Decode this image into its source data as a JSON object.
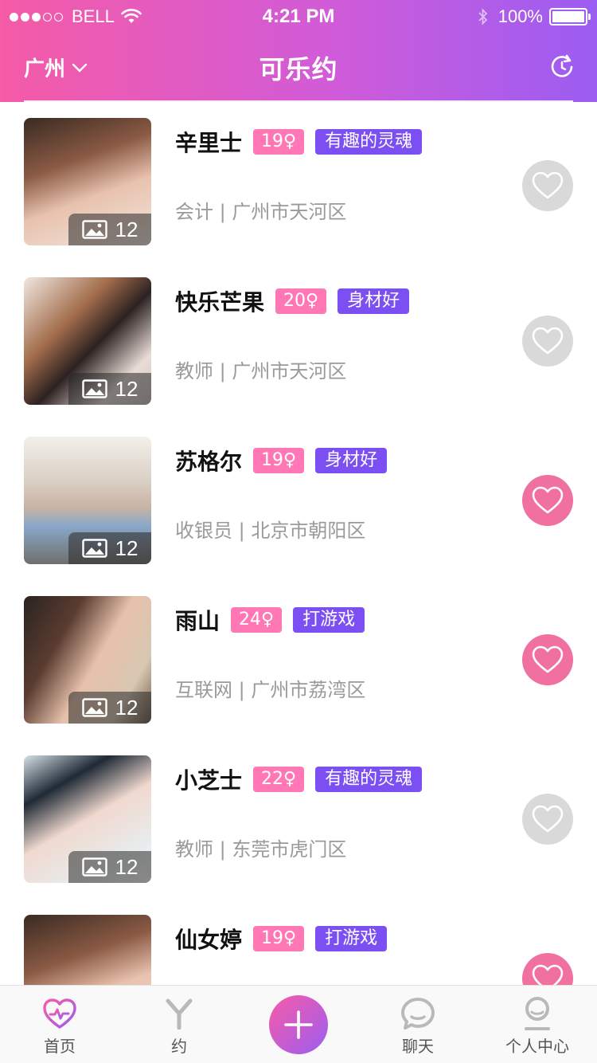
{
  "status_bar": {
    "carrier": "BELL",
    "time": "4:21 PM",
    "battery": "100%"
  },
  "header": {
    "city": "广州",
    "title": "可乐约"
  },
  "profiles": [
    {
      "name": "辛里士",
      "age": "19♀",
      "tag": "有趣的灵魂",
      "info": "会计 | 广州市天河区",
      "photo_count": "12",
      "liked": false
    },
    {
      "name": "快乐芒果",
      "age": "20♀",
      "tag": "身材好",
      "info": "教师 | 广州市天河区",
      "photo_count": "12",
      "liked": false
    },
    {
      "name": "苏格尔",
      "age": "19♀",
      "tag": "身材好",
      "info": "收银员 | 北京市朝阳区",
      "photo_count": "12",
      "liked": true
    },
    {
      "name": "雨山",
      "age": "24♀",
      "tag": "打游戏",
      "info": "互联网 | 广州市荔湾区",
      "photo_count": "12",
      "liked": true
    },
    {
      "name": "小芝士",
      "age": "22♀",
      "tag": "有趣的灵魂",
      "info": "教师 | 东莞市虎门区",
      "photo_count": "12",
      "liked": false
    },
    {
      "name": "仙女婷",
      "age": "19♀",
      "tag": "打游戏",
      "info": "",
      "photo_count": "",
      "liked": true
    }
  ],
  "tabbar": {
    "home": "首页",
    "date": "约",
    "chat": "聊天",
    "profile": "个人中心"
  },
  "colors": {
    "header_gradient_start": "#f55ba6",
    "header_gradient_end": "#9b5df2",
    "age_badge": "#ff78b5",
    "tag_badge": "#7b4ff2",
    "like_active": "#f0719f",
    "like_inactive": "#d9d9d9"
  },
  "icons": [
    "wifi-icon",
    "bluetooth-icon",
    "battery-icon",
    "chevron-down-icon",
    "refresh-icon",
    "image-icon",
    "heart-icon",
    "heartbeat-icon",
    "y-icon",
    "plus-icon",
    "chat-bubble-icon",
    "person-icon"
  ]
}
